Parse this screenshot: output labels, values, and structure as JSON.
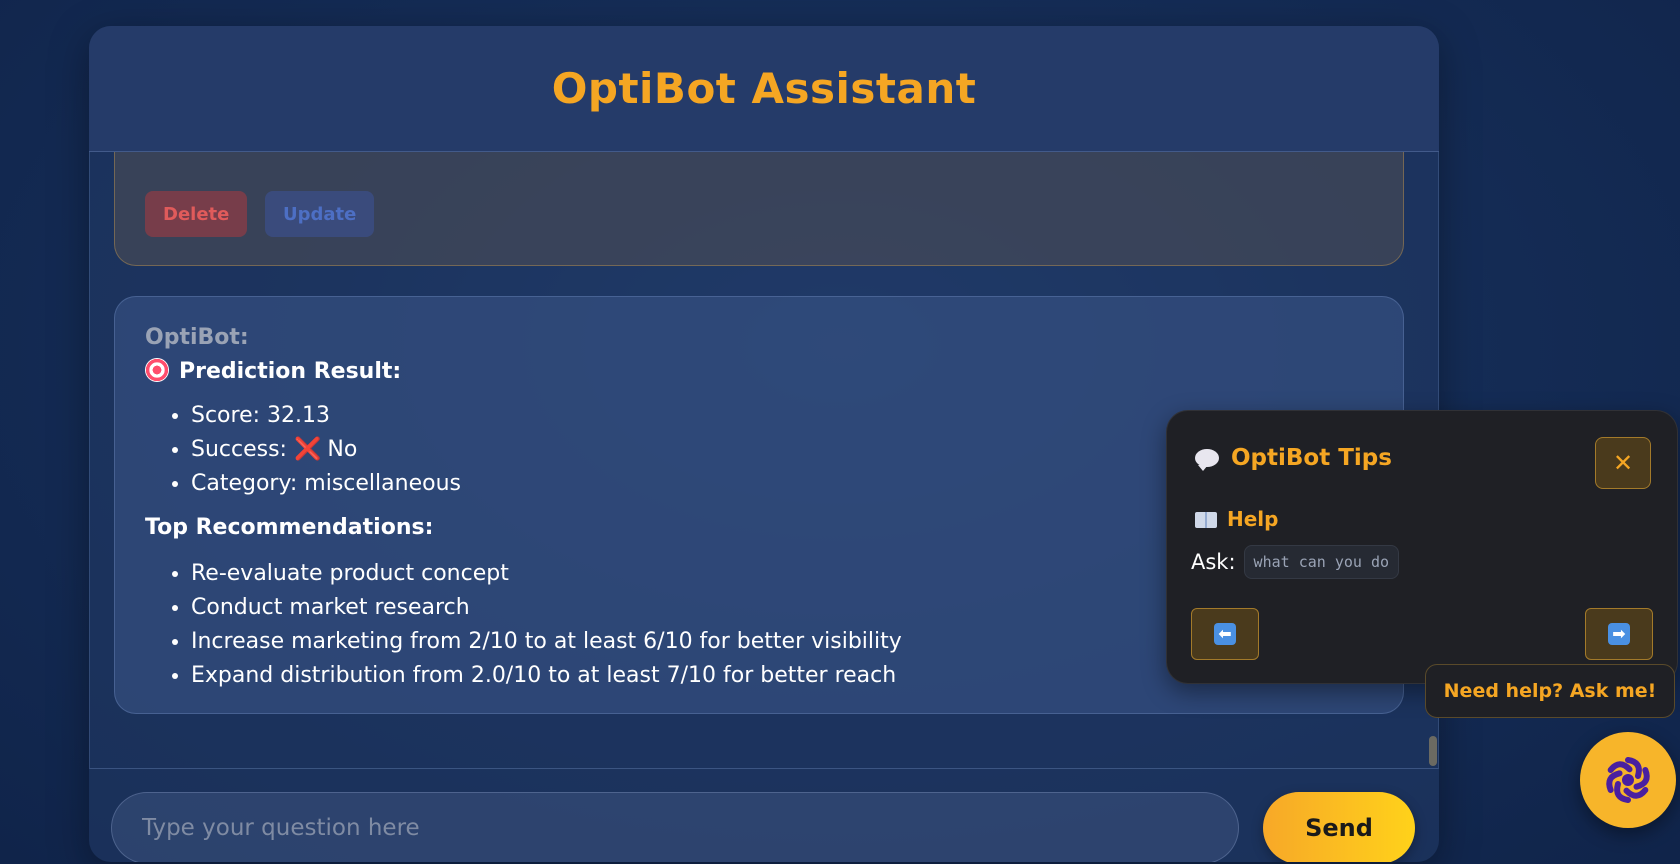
{
  "header": {
    "title": "OptiBot Assistant"
  },
  "previous_message": {
    "delete_label": "Delete",
    "update_label": "Update"
  },
  "bot_message": {
    "sender": "OptiBot:",
    "prediction_title": "Prediction Result:",
    "prediction_items": [
      {
        "text": "Score: 32.13"
      },
      {
        "prefix": "Success:",
        "mark": "❌",
        "suffix": "No"
      },
      {
        "text": "Category: miscellaneous"
      }
    ],
    "recommendations_title": "Top Recommendations:",
    "recommendations": [
      "Re-evaluate product concept",
      "Conduct market research",
      "Increase marketing from 2/10 to at least 6/10 for better visibility",
      "Expand distribution from 2.0/10 to at least 7/10 for better reach"
    ]
  },
  "input": {
    "placeholder": "Type your question here",
    "value": "",
    "send_label": "Send"
  },
  "tips": {
    "title": "OptiBot Tips",
    "close_symbol": "✕",
    "section_title": "Help",
    "ask_label": "Ask:",
    "ask_example": "what can you do",
    "prev_symbol": "⬅",
    "next_symbol": "➡"
  },
  "help_bubble": {
    "text": "Need help? Ask me!"
  },
  "colors": {
    "accent": "#f5a623",
    "send_gradient_end": "#ffd21a",
    "background": "#152d57",
    "delete": "#e05b5b",
    "update": "#4d6fc4"
  },
  "icons": {
    "target": "target-icon",
    "cross": "cross-mark-icon",
    "speech": "speech-bubble-icon",
    "book": "book-icon",
    "fab": "optibot-swirl-icon"
  }
}
